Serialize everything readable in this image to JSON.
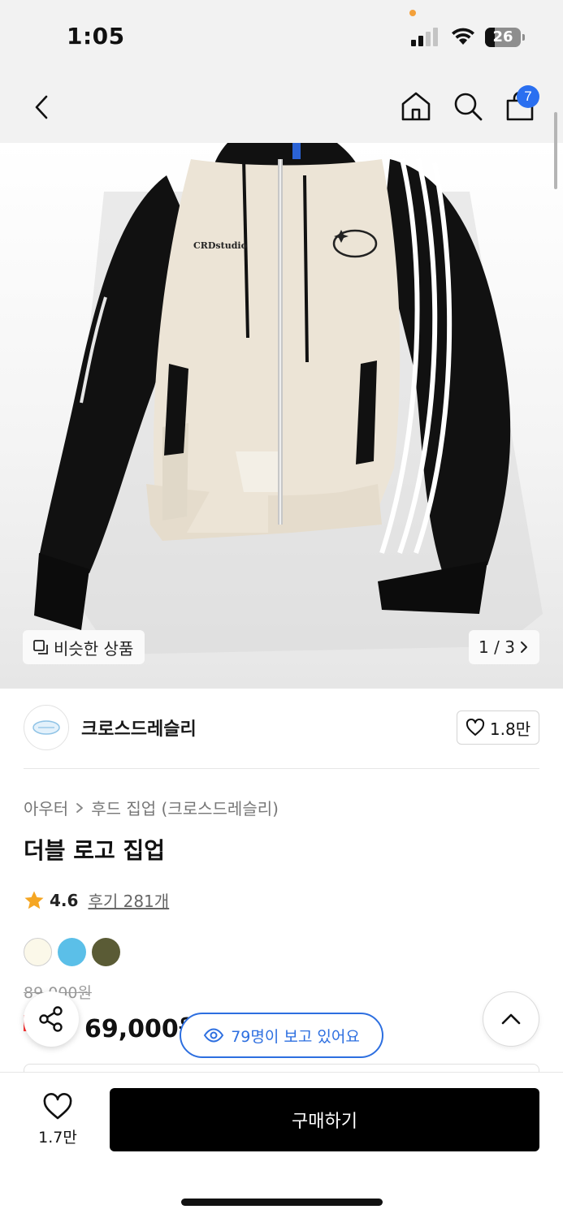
{
  "status_bar": {
    "time": "1:05",
    "battery": "26"
  },
  "nav": {
    "back_icon": "chevron-left-icon",
    "home_icon": "home-icon",
    "search_icon": "search-icon",
    "cart_icon": "shopping-bag-icon",
    "cart_count": "7"
  },
  "hero": {
    "similar_label": "비슷한 상품",
    "page_indicator": "1 / 3",
    "image_count": 3,
    "current_image": 1
  },
  "brand": {
    "name": "크로스드레슬리",
    "like_count": "1.8만"
  },
  "product": {
    "breadcrumb": [
      "아우터",
      "후드 집업 (크로스드레슬리)"
    ],
    "title": "더블 로고 집업",
    "rating": "4.6",
    "reviews": "후기 281개",
    "swatches": [
      "#fbf8e9",
      "#5bbfe8",
      "#5a5b35"
    ],
    "original_price": "89,000원",
    "sale_price": "69,000원"
  },
  "viewers": {
    "text": "79명이 보고 있어요"
  },
  "bottom": {
    "wish_count": "1.7만",
    "buy_label": "구매하기"
  },
  "colors": {
    "accent_blue": "#2d6fe0",
    "badge_blue": "#2a6ff0",
    "star": "#f5a623",
    "discount_red": "#ff3333"
  }
}
